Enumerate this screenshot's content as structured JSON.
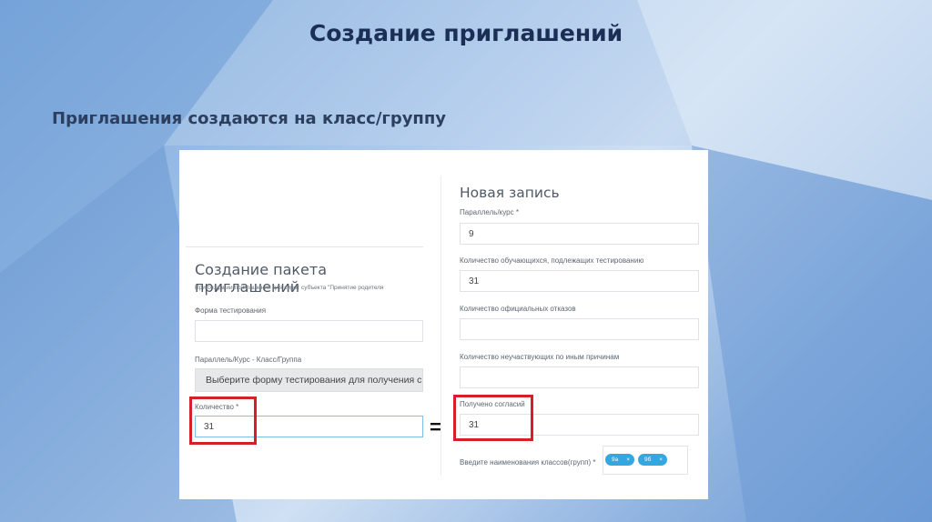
{
  "slide": {
    "title": "Создание приглашений",
    "subtitle": "Приглашения создаются на класс/группу"
  },
  "left_form": {
    "header": "Создание пакета приглашений",
    "hint": "При создании приглашений для сирот субъекта \"Принятие родителя",
    "form_label": "Форма тестирования",
    "parallel_label": "Параллель/Курс - Класс/Группа",
    "parallel_placeholder": "Выберите форму тестирования для получения спи",
    "count_label": "Количество *",
    "count_value": "31"
  },
  "equals_sign": "=",
  "right_form": {
    "header": "Новая запись",
    "parallel_label": "Параллель/курс *",
    "parallel_value": "9",
    "students_label": "Количество обучающихся, подлежащих тестированию",
    "students_value": "31",
    "refusals_label": "Количество официальных отказов",
    "refusals_value": "",
    "absent_label": "Количество неучаствующих по иным причинам",
    "absent_value": "",
    "consents_label": "Получено согласий",
    "consents_value": "31",
    "classes_label": "Введите наименования классов(групп) *",
    "class_tags": [
      {
        "label": "9а",
        "remove": "×"
      },
      {
        "label": "9б",
        "remove": "×"
      }
    ]
  },
  "colors": {
    "highlight": "#d4202a",
    "tag": "#34a6e0",
    "title": "#1b2f55"
  }
}
